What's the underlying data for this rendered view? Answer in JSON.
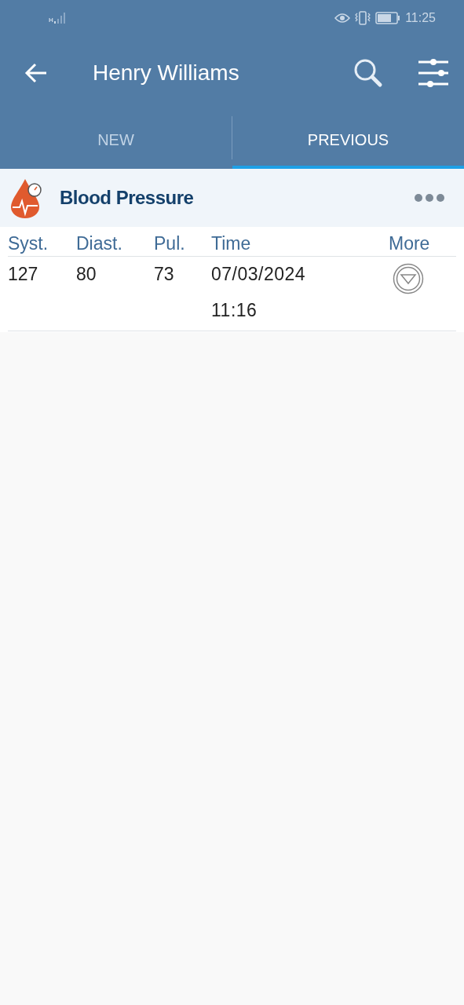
{
  "status_bar": {
    "network": "H",
    "time": "11:25"
  },
  "header": {
    "title": "Henry Williams"
  },
  "tabs": [
    {
      "label": "NEW",
      "selected": false
    },
    {
      "label": "PREVIOUS",
      "selected": true
    }
  ],
  "card": {
    "title": "Blood Pressure",
    "table": {
      "columns": [
        "Syst.",
        "Diast.",
        "Pul.",
        "Time",
        "More"
      ],
      "rows": [
        {
          "syst": "127",
          "diast": "80",
          "pul": "73",
          "date": "07/03/2024",
          "time": "11:16"
        }
      ]
    }
  }
}
